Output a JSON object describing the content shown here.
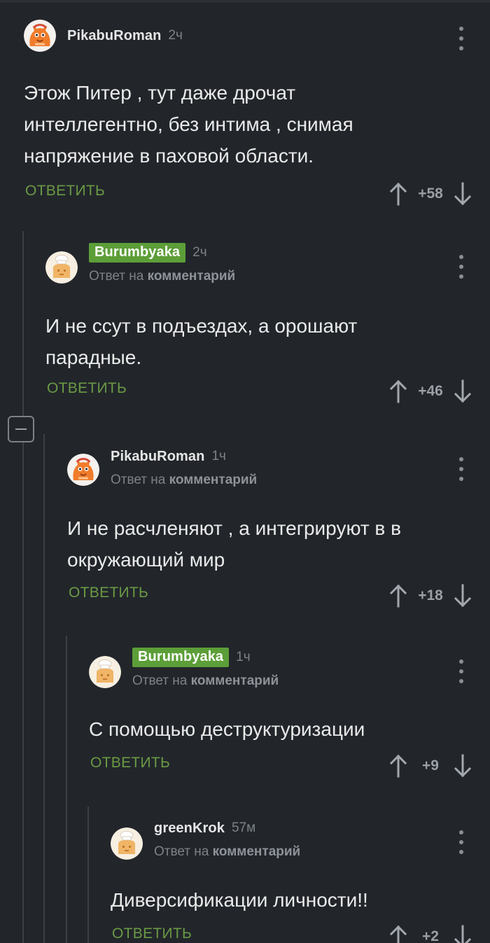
{
  "labels": {
    "reply": "ОТВЕТИТЬ",
    "reply_to_prefix": "Ответ на",
    "reply_to_target": "комментарий"
  },
  "comments": [
    {
      "username": "PikabuRoman",
      "time": "2ч",
      "text": "Этож Питер , тут даже дрочат интеллегентно, без интима , снимая напряжение в паховой области.",
      "score": "+58",
      "avatar": "orange-cat-avatar-icon"
    },
    {
      "username": "Burumbyaka",
      "time": "2ч",
      "text": "И не ссут в подъездах, а орошают парадные.",
      "score": "+46",
      "avatar": "chef-avatar-icon",
      "badge_color": "#5c9e38"
    },
    {
      "username": "PikabuRoman",
      "time": "1ч",
      "text": "И не расчленяют , а интегрируют в в окружающий мир",
      "score": "+18",
      "avatar": "orange-cat-avatar-icon"
    },
    {
      "username": "Burumbyaka",
      "time": "1ч",
      "text": "С помощью деструктуризации",
      "score": "+9",
      "avatar": "chef-avatar-icon",
      "badge_color": "#5c9e38"
    },
    {
      "username": "greenKrok",
      "time": "57м",
      "text": "Диверсификации личности!!",
      "score": "+2",
      "avatar": "chef-avatar-icon"
    }
  ],
  "colors": {
    "background": "#22262b",
    "reply_green": "#6a9a44",
    "badge_green": "#5c9e38",
    "muted_text": "#7d8288"
  }
}
